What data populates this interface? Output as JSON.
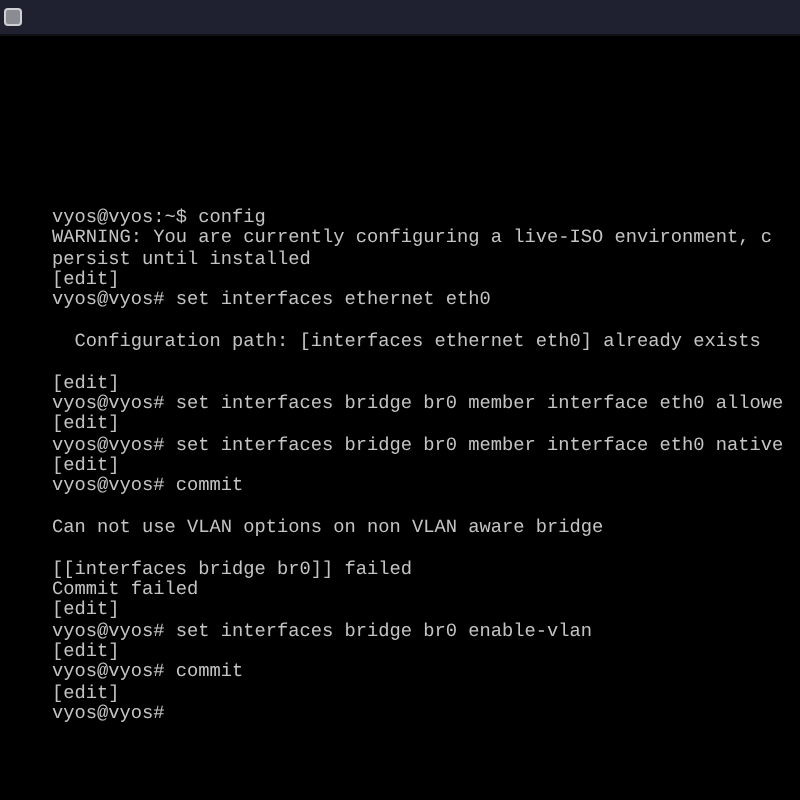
{
  "terminal": {
    "lines": [
      {
        "kind": "text",
        "text": "vyos@vyos:~$ config"
      },
      {
        "kind": "text",
        "text": "WARNING: You are currently configuring a live-ISO environment, c"
      },
      {
        "kind": "text",
        "text": "persist until installed"
      },
      {
        "kind": "text",
        "text": "[edit]"
      },
      {
        "kind": "text",
        "text": "vyos@vyos# set interfaces ethernet eth0"
      },
      {
        "kind": "blank"
      },
      {
        "kind": "text",
        "text": "  Configuration path: [interfaces ethernet eth0] already exists"
      },
      {
        "kind": "blank"
      },
      {
        "kind": "text",
        "text": "[edit]"
      },
      {
        "kind": "text",
        "text": "vyos@vyos# set interfaces bridge br0 member interface eth0 allowe"
      },
      {
        "kind": "text",
        "text": "[edit]"
      },
      {
        "kind": "text",
        "text": "vyos@vyos# set interfaces bridge br0 member interface eth0 native"
      },
      {
        "kind": "text",
        "text": "[edit]"
      },
      {
        "kind": "text",
        "text": "vyos@vyos# commit"
      },
      {
        "kind": "blank"
      },
      {
        "kind": "text",
        "text": "Can not use VLAN options on non VLAN aware bridge"
      },
      {
        "kind": "blank"
      },
      {
        "kind": "text",
        "text": "[[interfaces bridge br0]] failed"
      },
      {
        "kind": "text",
        "text": "Commit failed"
      },
      {
        "kind": "text",
        "text": "[edit]"
      },
      {
        "kind": "text",
        "text": "vyos@vyos# set interfaces bridge br0 enable-vlan"
      },
      {
        "kind": "text",
        "text": "[edit]"
      },
      {
        "kind": "text",
        "text": "vyos@vyos# commit"
      },
      {
        "kind": "text",
        "text": "[edit]"
      },
      {
        "kind": "text",
        "text": "vyos@vyos#"
      }
    ]
  }
}
